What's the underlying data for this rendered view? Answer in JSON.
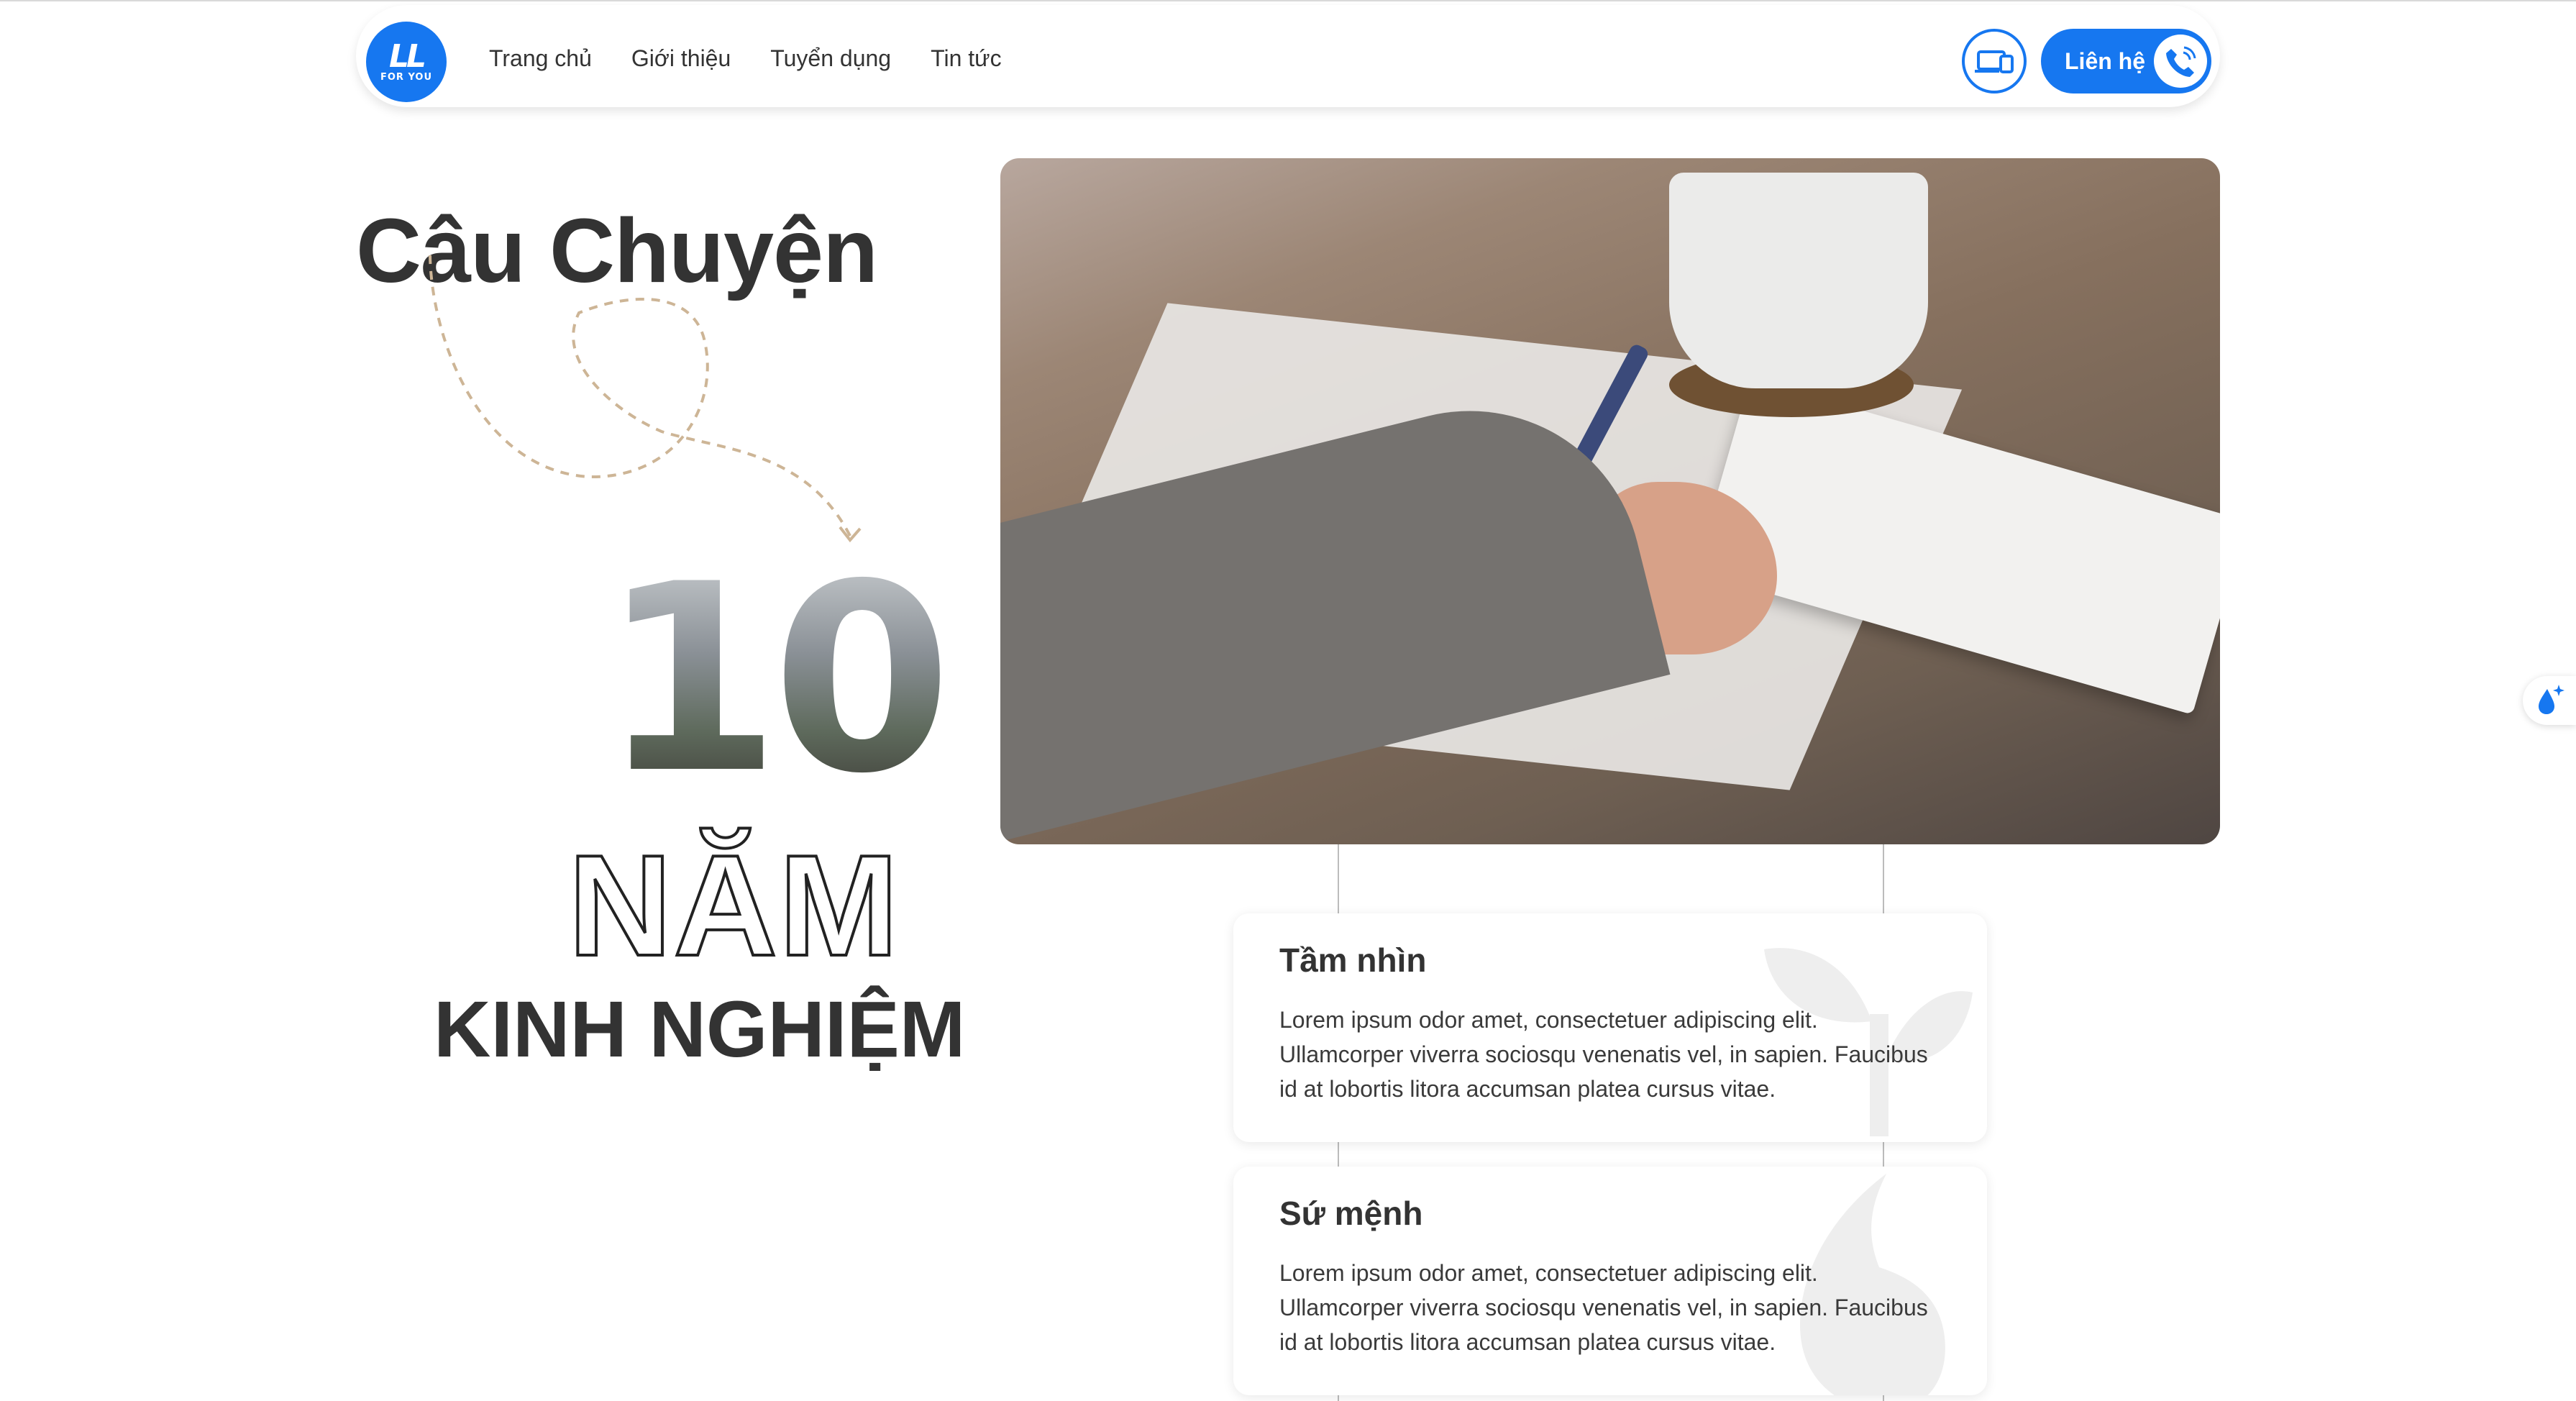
{
  "nav": {
    "logo": {
      "mark": "LL",
      "sub": "FOR YOU"
    },
    "items": [
      {
        "label": "Trang chủ"
      },
      {
        "label": "Giới thiệu"
      },
      {
        "label": "Tuyển dụng"
      },
      {
        "label": "Tin tức"
      }
    ],
    "contact_label": "Liên hệ",
    "accent": "#1677f0"
  },
  "hero": {
    "heading": "Câu Chuyện",
    "years_number": "10",
    "years_word": "NĂM",
    "experience": "KINH NGHIỆM"
  },
  "cards": [
    {
      "title": "Tầm nhìn",
      "text": "Lorem ipsum odor amet, consectetuer adipiscing elit. Ullamcorper viverra sociosqu venenatis vel, in sapien. Faucibus id at lobortis litora accumsan platea cursus vitae.",
      "icon": "leaf-icon"
    },
    {
      "title": "Sứ mệnh",
      "text": "Lorem ipsum odor amet, consectetuer adipiscing elit. Ullamcorper viverra sociosqu venenatis vel, in sapien. Faucibus id at lobortis litora accumsan platea cursus vitae.",
      "icon": "drop-icon"
    }
  ]
}
